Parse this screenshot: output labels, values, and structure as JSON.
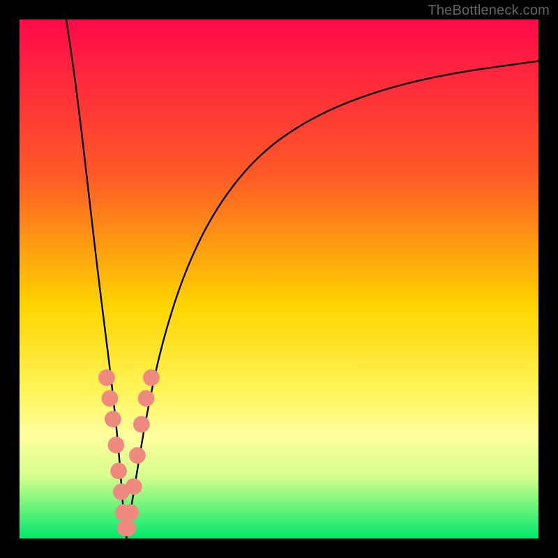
{
  "watermark": "TheBottleneck.com",
  "chart_data": {
    "type": "line",
    "title": "",
    "xlabel": "",
    "ylabel": "",
    "xlim": [
      0,
      100
    ],
    "ylim": [
      0,
      100
    ],
    "grid": false,
    "legend": false,
    "gradient_stops": [
      {
        "offset": 0,
        "color": "#ff0a4a"
      },
      {
        "offset": 30,
        "color": "#ff5a26"
      },
      {
        "offset": 55,
        "color": "#fdd400"
      },
      {
        "offset": 72,
        "color": "#fff55a"
      },
      {
        "offset": 80,
        "color": "#ffff9e"
      },
      {
        "offset": 88,
        "color": "#d6ff8c"
      },
      {
        "offset": 100,
        "color": "#00e86b"
      }
    ],
    "series": [
      {
        "name": "left-branch",
        "x": [
          9.0,
          10.5,
          12.0,
          13.5,
          15.0,
          16.5,
          18.0,
          19.2,
          19.8,
          20.2,
          20.6
        ],
        "y": [
          100,
          90,
          78,
          65,
          52,
          40,
          28,
          16,
          8,
          3,
          0
        ]
      },
      {
        "name": "right-branch",
        "x": [
          20.6,
          21.2,
          22.5,
          24.5,
          27.5,
          32.0,
          38.0,
          46.0,
          56.0,
          68.0,
          82.0,
          100.0
        ],
        "y": [
          0,
          4,
          12,
          24,
          38,
          52,
          64,
          74,
          81,
          86,
          89.5,
          92
        ]
      }
    ],
    "markers": {
      "name": "salmon-dots",
      "color": "#ef8a80",
      "radius": 1.6,
      "points": [
        {
          "x": 16.8,
          "y": 31
        },
        {
          "x": 17.4,
          "y": 27
        },
        {
          "x": 18.0,
          "y": 23
        },
        {
          "x": 18.6,
          "y": 18
        },
        {
          "x": 19.1,
          "y": 13
        },
        {
          "x": 19.6,
          "y": 9
        },
        {
          "x": 20.0,
          "y": 5
        },
        {
          "x": 20.4,
          "y": 2
        },
        {
          "x": 20.9,
          "y": 2
        },
        {
          "x": 21.4,
          "y": 5
        },
        {
          "x": 22.0,
          "y": 10
        },
        {
          "x": 22.7,
          "y": 16
        },
        {
          "x": 23.5,
          "y": 22
        },
        {
          "x": 24.4,
          "y": 27
        },
        {
          "x": 25.4,
          "y": 31
        }
      ]
    }
  }
}
